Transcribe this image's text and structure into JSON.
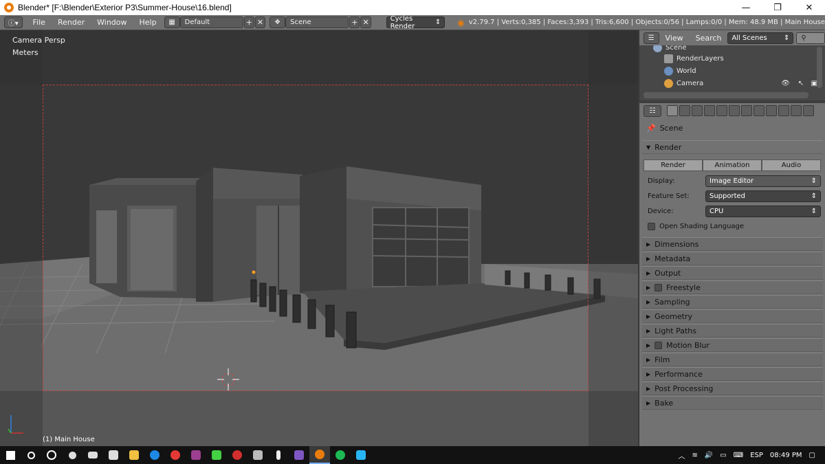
{
  "window": {
    "title": "Blender* [F:\\Blender\\Exterior P3\\Summer-House\\16.blend]",
    "minimize": "—",
    "maximize": "❐",
    "close": "✕"
  },
  "info_header": {
    "menus": [
      "File",
      "Render",
      "Window",
      "Help"
    ],
    "screen_layout": "Default",
    "scene": "Scene",
    "engine": "Cycles Render",
    "stats": "v2.79.7 | Verts:0,385 | Faces:3,393 | Tris:6,600 | Objects:0/56 | Lamps:0/0 | Mem: 48.9 MB | Main House"
  },
  "viewport": {
    "view_name": "Camera Persp",
    "units": "Meters",
    "active_object": "(1) Main House"
  },
  "outliner": {
    "view_menu": "View",
    "search_menu": "Search",
    "filter": "All Scenes",
    "items": [
      {
        "label": "Scene",
        "color": "#8fa8c8"
      },
      {
        "label": "RenderLayers",
        "color": "#9a9a9a"
      },
      {
        "label": "World",
        "color": "#6a8fc0"
      },
      {
        "label": "Camera",
        "color": "#e0a040"
      }
    ]
  },
  "properties": {
    "context": "Scene",
    "render_panel": {
      "title": "Render",
      "buttons": [
        "Render",
        "Animation",
        "Audio"
      ],
      "display_label": "Display:",
      "display_value": "Image Editor",
      "feature_set_label": "Feature Set:",
      "feature_set_value": "Supported",
      "device_label": "Device:",
      "device_value": "CPU",
      "osl_label": "Open Shading Language"
    },
    "panels": [
      {
        "label": "Dimensions",
        "checkbox": false
      },
      {
        "label": "Metadata",
        "checkbox": false
      },
      {
        "label": "Output",
        "checkbox": false
      },
      {
        "label": "Freestyle",
        "checkbox": true
      },
      {
        "label": "Sampling",
        "checkbox": false
      },
      {
        "label": "Geometry",
        "checkbox": false
      },
      {
        "label": "Light Paths",
        "checkbox": false
      },
      {
        "label": "Motion Blur",
        "checkbox": true
      },
      {
        "label": "Film",
        "checkbox": false
      },
      {
        "label": "Performance",
        "checkbox": false
      },
      {
        "label": "Post Processing",
        "checkbox": false
      },
      {
        "label": "Bake",
        "checkbox": false
      }
    ]
  },
  "taskbar": {
    "language": "ESP",
    "time": "08:49 PM"
  }
}
